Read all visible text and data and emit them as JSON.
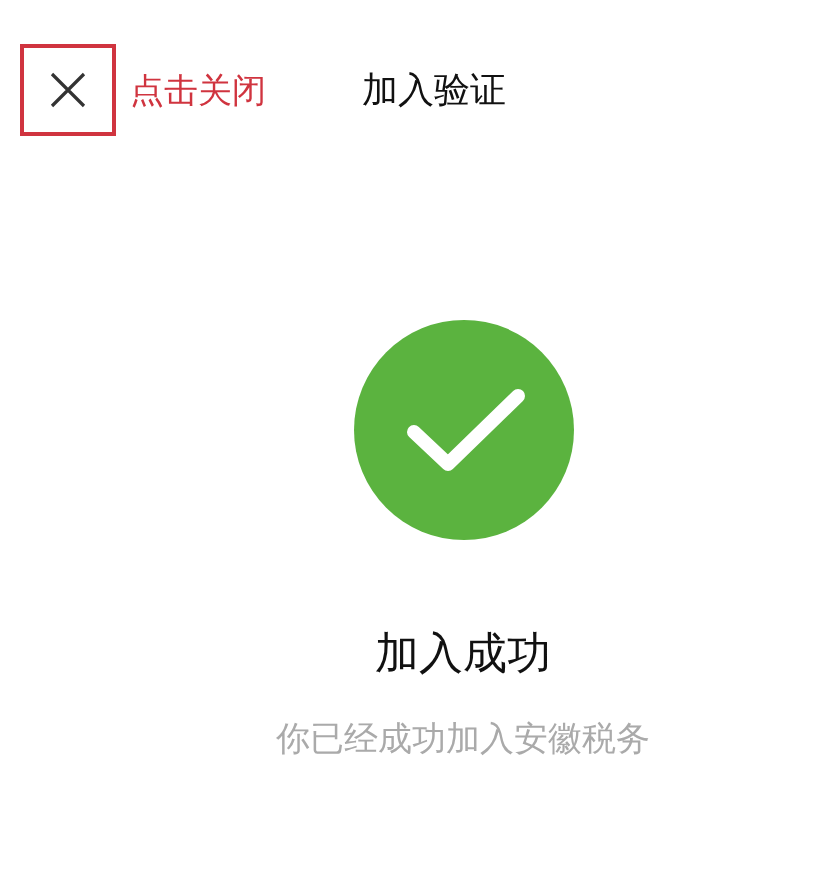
{
  "header": {
    "title": "加入验证"
  },
  "annotation": {
    "text": "点击关闭"
  },
  "result": {
    "title": "加入成功",
    "message": "你已经成功加入安徽税务"
  }
}
